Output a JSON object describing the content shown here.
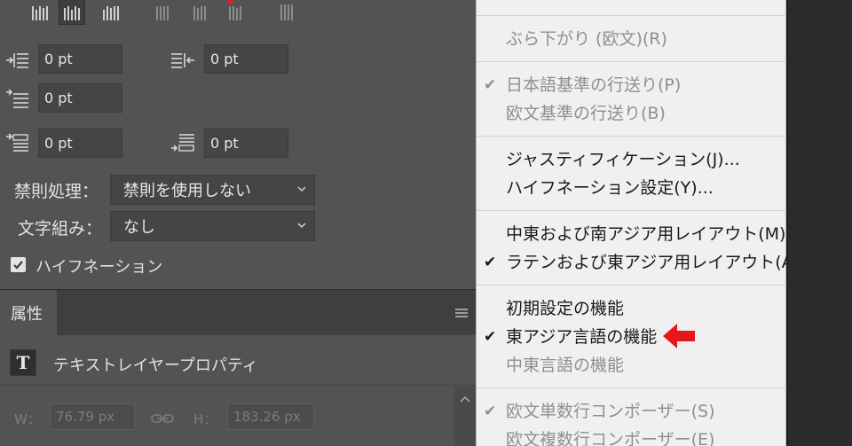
{
  "paragraph_panel": {
    "indent_left": "0 pt",
    "indent_right": "0 pt",
    "indent_first_line": "0 pt",
    "space_before": "0 pt",
    "space_after": "0 pt",
    "kinsoku_label": "禁則処理：",
    "kinsoku_value": "禁則を使用しない",
    "mojikumi_label": "文字組み：",
    "mojikumi_value": "なし",
    "hyphenate_label": "ハイフネーション",
    "hyphenate_checked": true
  },
  "properties_panel": {
    "tab_label": "属性",
    "layer_type_label": "テキストレイヤープロパティ",
    "w_label": "W：",
    "w_value": "76.79 px",
    "h_label": "H：",
    "h_value": "183.26 px"
  },
  "menu": {
    "top_partial": "",
    "items": [
      {
        "label": "ぶら下がり (欧文)(R)",
        "enabled": false,
        "checked": false
      },
      {
        "label": "日本語基準の行送り(P)",
        "enabled": false,
        "checked": true
      },
      {
        "label": "欧文基準の行送り(B)",
        "enabled": false,
        "checked": false
      },
      {
        "label": "ジャスティフィケーション(J)...",
        "enabled": true,
        "checked": false
      },
      {
        "label": "ハイフネーション設定(Y)...",
        "enabled": true,
        "checked": false
      },
      {
        "label": "中東および南アジア用レイアウト(M)",
        "enabled": true,
        "checked": false
      },
      {
        "label": "ラテンおよび東アジア用レイアウト(A)",
        "enabled": true,
        "checked": true
      },
      {
        "label": "初期設定の機能",
        "enabled": true,
        "checked": false
      },
      {
        "label": "東アジア言語の機能",
        "enabled": true,
        "checked": true
      },
      {
        "label": "中東言語の機能",
        "enabled": false,
        "checked": false
      },
      {
        "label": "欧文単数行コンポーザー(S)",
        "enabled": false,
        "checked": true
      },
      {
        "label": "欧文複数行コンポーザー(E)",
        "enabled": false,
        "checked": false
      }
    ],
    "check_glyph": "✔"
  },
  "colors": {
    "panel_bg": "#535353",
    "menu_bg": "#f0f0f0",
    "arrow": "#e8161b"
  }
}
